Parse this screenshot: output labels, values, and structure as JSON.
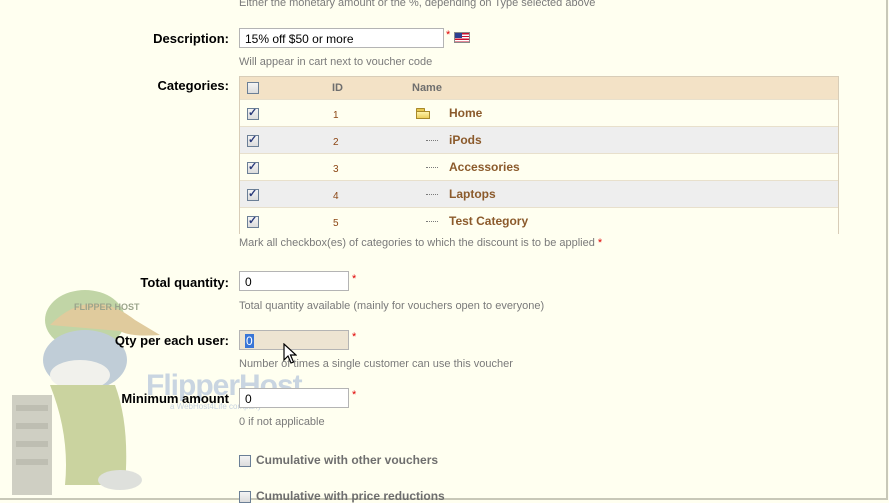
{
  "top_hint": "Either the monetary amount or the %, depending on Type selected above",
  "description": {
    "label": "Description:",
    "value": "15% off $50 or more",
    "hint": "Will appear in cart next to voucher code",
    "required_mark": "*"
  },
  "categories": {
    "label": "Categories:",
    "columns": {
      "id": "ID",
      "name": "Name"
    },
    "rows": [
      {
        "id": "1",
        "name": "Home",
        "checked": true
      },
      {
        "id": "2",
        "name": "iPods",
        "checked": true
      },
      {
        "id": "3",
        "name": "Accessories",
        "checked": true
      },
      {
        "id": "4",
        "name": "Laptops",
        "checked": true
      },
      {
        "id": "5",
        "name": "Test Category",
        "checked": true
      }
    ],
    "hint": "Mark all checkbox(es) of categories to which the discount is to be applied",
    "required_mark": "*"
  },
  "total_quantity": {
    "label": "Total quantity:",
    "value": "0",
    "hint": "Total quantity available (mainly for vouchers open to everyone)",
    "required_mark": "*"
  },
  "qty_per_user": {
    "label": "Qty per each user:",
    "value": "0",
    "hint": "Number of times a single customer can use this voucher",
    "required_mark": "*"
  },
  "minimum_amount": {
    "label": "Minimum amount",
    "value": "0",
    "hint": "0 if not applicable",
    "required_mark": "*"
  },
  "cumulative_vouchers": {
    "label": "Cumulative with other vouchers",
    "checked": false
  },
  "cumulative_price": {
    "label": "Cumulative with price reductions",
    "checked": false
  },
  "watermark": {
    "brand": "FlipperHost",
    "sub": "a WebHost4Life company",
    "cap_text": "FLIPPER HOST"
  },
  "icons": {
    "flag": "us-flag-icon",
    "folder": "folder-icon",
    "cursor": "mouse-cursor-icon"
  }
}
